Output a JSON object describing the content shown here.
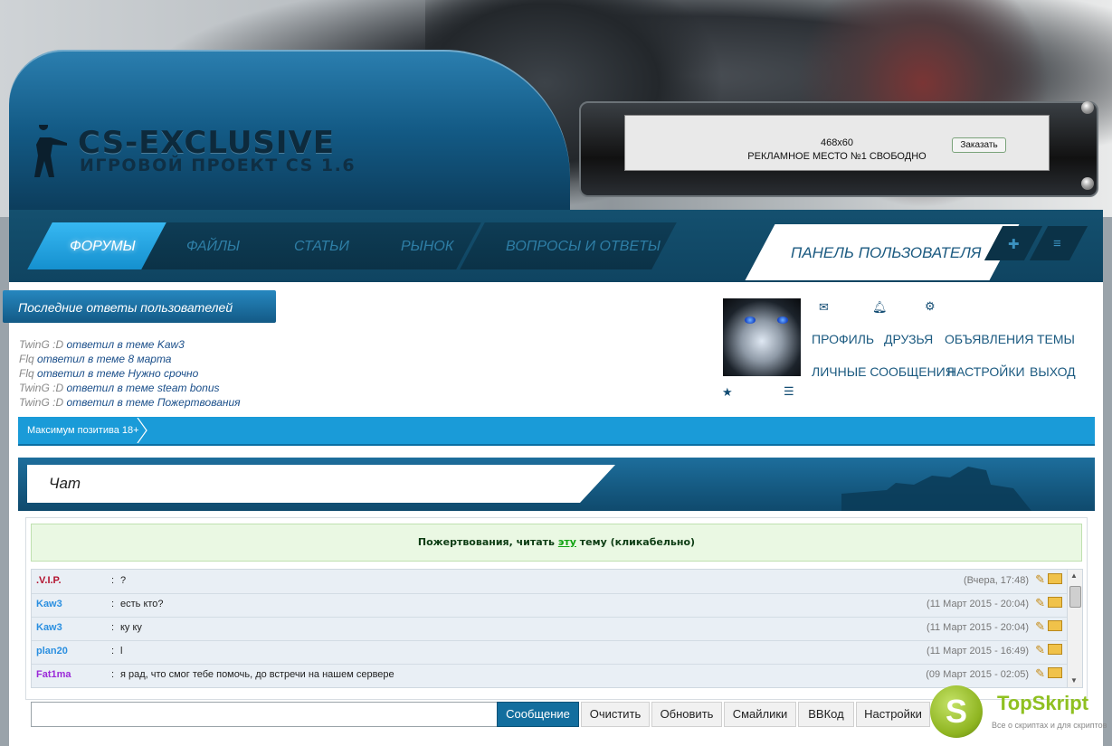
{
  "header": {
    "logo_title": "CS-EXCLUSIVE",
    "logo_subtitle": "ИГРОВОЙ ПРОЕКТ CS 1.6",
    "ad": {
      "size": "468x60",
      "text": "РЕКЛАМНОЕ МЕСТО №1 СВОБОДНО",
      "order_button": "Заказать"
    }
  },
  "nav": {
    "items": [
      {
        "label": "ФОРУМЫ",
        "active": true
      },
      {
        "label": "ФАЙЛЫ",
        "active": false
      },
      {
        "label": "СТАТЬИ",
        "active": false
      },
      {
        "label": "РЫНОК",
        "active": false
      },
      {
        "label": "ВОПРОСЫ И ОТВЕТЫ",
        "active": false
      }
    ],
    "user_panel_label": "ПАНЕЛЬ ПОЛЬЗОВАТЕЛЯ"
  },
  "recent": {
    "title": "Последние ответы пользователей",
    "items": [
      {
        "user": "TwinG :D",
        "text": "ответил в теме Kaw3"
      },
      {
        "user": "Flq",
        "text": "ответил в теме 8 марта"
      },
      {
        "user": "Flq",
        "text": "ответил в теме Нужно срочно"
      },
      {
        "user": "TwinG :D",
        "text": "ответил в теме steam bonus"
      },
      {
        "user": "TwinG :D",
        "text": "ответил в теме Пожертвования"
      }
    ]
  },
  "user_panel": {
    "links": [
      "ПРОФИЛЬ",
      "ДРУЗЬЯ",
      "ОБЪЯВЛЕНИЯ",
      "ТЕМЫ",
      "ЛИЧНЫЕ СООБЩЕНИЯ",
      "НАСТРОЙКИ",
      "ВЫХОД"
    ]
  },
  "breadcrumb": {
    "text": "Максимум позитива 18+"
  },
  "chat": {
    "title": "Чат",
    "notice": {
      "prefix": "Пожертвования, читать ",
      "link": "эту",
      "suffix": " тему (кликабельно)"
    },
    "messages": [
      {
        "nick": ".V.I.P.",
        "nick_color": "#b3122e",
        "text": "?",
        "time": "(Вчера, 17:48)"
      },
      {
        "nick": "Kaw3",
        "nick_color": "#2a8fe0",
        "text": "есть кто?",
        "time": "(11 Март 2015 - 20:04)"
      },
      {
        "nick": "Kaw3",
        "nick_color": "#2a8fe0",
        "text": "ку ку",
        "time": "(11 Март 2015 - 20:04)"
      },
      {
        "nick": "plan20",
        "nick_color": "#2a8fe0",
        "text": "l",
        "time": "(11 Март 2015 - 16:49)"
      },
      {
        "nick": "Fat1ma",
        "nick_color": "#9b2ad8",
        "text": "я рад, что смог тебе помочь, до встречи на нашем сервере",
        "time": "(09 Март 2015 - 02:05)"
      }
    ],
    "buttons": {
      "send": "Сообщение",
      "clear": "Очистить",
      "refresh": "Обновить",
      "smilies": "Смайлики",
      "bbcode": "BBКод",
      "settings": "Настройки"
    }
  },
  "watermark": {
    "logo_letter": "S",
    "title": "TopSkript",
    "subtitle": "Все о скриптах и для скриптов"
  },
  "colors": {
    "accent": "#1a9bd8",
    "nav_dark": "#0f4461",
    "link": "#1b5a80"
  }
}
